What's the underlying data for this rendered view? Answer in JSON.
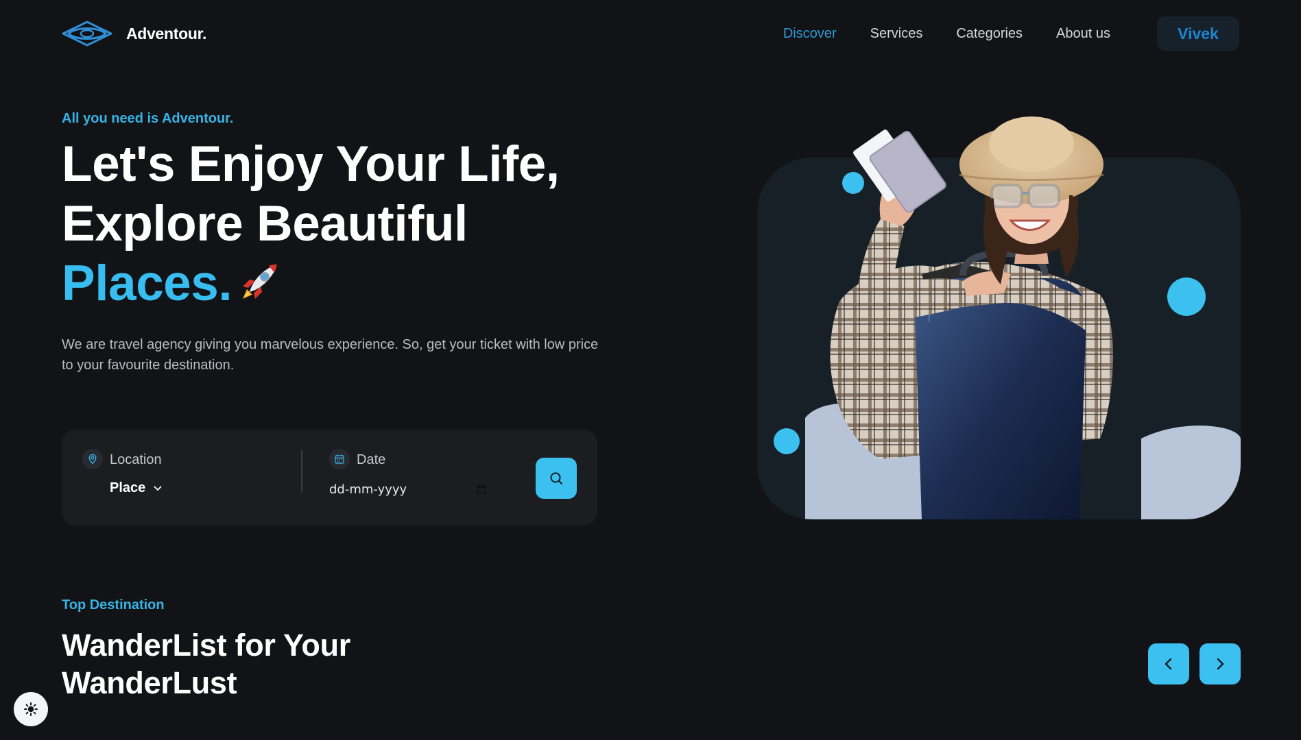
{
  "brand": {
    "name": "Adventour.",
    "logo_icon": "eye-logo-icon"
  },
  "nav": {
    "items": [
      {
        "label": "Discover",
        "active": true
      },
      {
        "label": "Services",
        "active": false
      },
      {
        "label": "Categories",
        "active": false
      },
      {
        "label": "About us",
        "active": false
      }
    ],
    "user_label": "Vivek"
  },
  "hero": {
    "eyebrow": "All you need is Adventour.",
    "title_line1": "Let's Enjoy Your Life,",
    "title_line2": "Explore Beautiful",
    "title_accent": "Places.",
    "title_emoji": "rocket-icon",
    "subtitle": "We are travel agency giving you marvelous experience. So, get your ticket with low price to your favourite destination."
  },
  "search": {
    "location_label": "Location",
    "location_value": "Place",
    "date_label": "Date",
    "date_placeholder": "dd-mm-yyyy"
  },
  "top_destination": {
    "eyebrow": "Top Destination",
    "title_line1": "WanderList for Your",
    "title_line2": "WanderLust"
  },
  "colors": {
    "background": "#111316",
    "accent": "#38bdf0",
    "nav_active": "#2f9bd6",
    "card": "#1b1d21",
    "hero_panel": "#172027"
  }
}
